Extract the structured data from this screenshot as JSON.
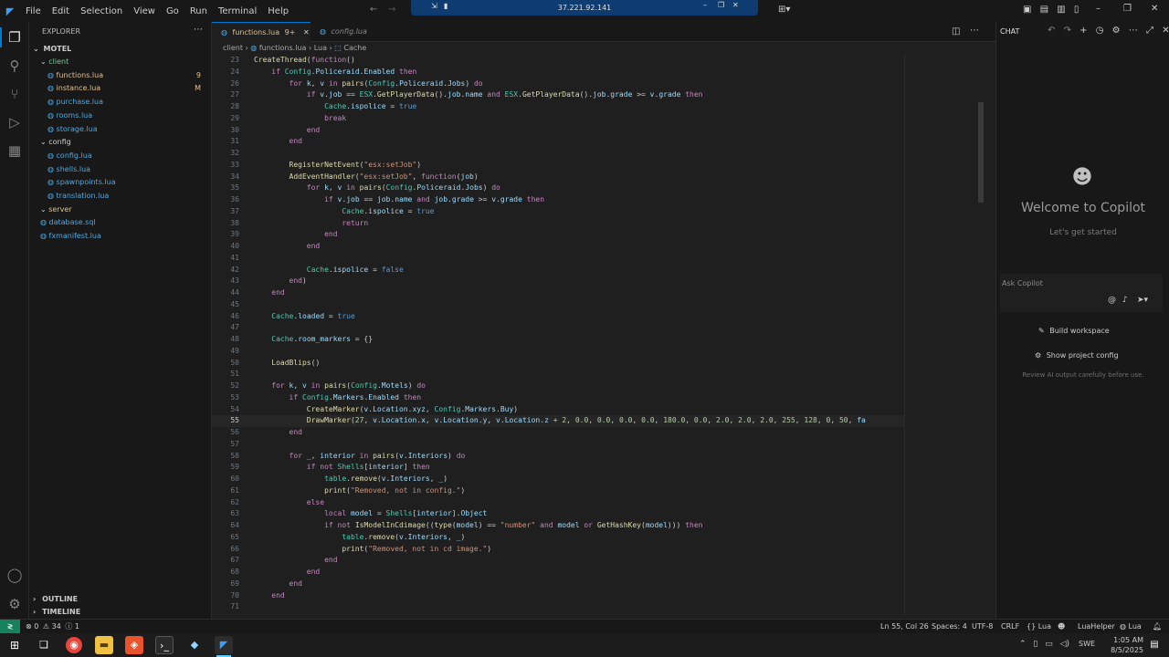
{
  "titlebar": {
    "menu": [
      "File",
      "Edit",
      "Selection",
      "View",
      "Go",
      "Run",
      "Terminal",
      "Help"
    ],
    "remote_address": "37.221.92.141"
  },
  "sidebar": {
    "header": "EXPLORER",
    "root": "MOTEL",
    "items": [
      {
        "label": "client",
        "type": "folder",
        "color": "#73c991"
      },
      {
        "label": "functions.lua",
        "type": "file",
        "color": "#e2c08d",
        "badge": "9"
      },
      {
        "label": "instance.lua",
        "type": "file",
        "color": "#e2c08d",
        "badge": "M"
      },
      {
        "label": "purchase.lua",
        "type": "file",
        "color": "#4fa8e0",
        "badge": ""
      },
      {
        "label": "rooms.lua",
        "type": "file",
        "color": "#4fa8e0",
        "badge": ""
      },
      {
        "label": "storage.lua",
        "type": "file",
        "color": "#4fa8e0",
        "badge": ""
      },
      {
        "label": "config",
        "type": "folder",
        "color": "#cccccc",
        "badge": ""
      },
      {
        "label": "config.lua",
        "type": "file",
        "color": "#4fa8e0",
        "badge": ""
      },
      {
        "label": "shells.lua",
        "type": "file",
        "color": "#4fa8e0",
        "badge": ""
      },
      {
        "label": "spawnpoints.lua",
        "type": "file",
        "color": "#4fa8e0",
        "badge": ""
      },
      {
        "label": "translation.lua",
        "type": "file",
        "color": "#4fa8e0",
        "badge": ""
      },
      {
        "label": "server",
        "type": "folder",
        "color": "#e2c08d",
        "badge": ""
      },
      {
        "label": "database.sql",
        "type": "file",
        "color": "#4fa8e0",
        "badge": ""
      },
      {
        "label": "fxmanifest.lua",
        "type": "file",
        "color": "#4fa8e0",
        "badge": ""
      }
    ],
    "outline": "OUTLINE",
    "timeline": "TIMELINE"
  },
  "tabs": [
    {
      "label": "functions.lua",
      "badge": "9+",
      "active": true
    },
    {
      "label": "config.lua",
      "badge": "",
      "active": false
    }
  ],
  "breadcrumb": [
    "client",
    "functions.lua",
    "Lua",
    "Cache"
  ],
  "code": [
    {
      "n": "23",
      "t": "CreateThread(function()"
    },
    {
      "n": "24",
      "t": "    if Config.Policeraid.Enabled then"
    },
    {
      "n": "26",
      "t": "        for k, v in pairs(Config.Policeraid.Jobs) do"
    },
    {
      "n": "27",
      "t": "            if v.job == ESX.GetPlayerData().job.name and ESX.GetPlayerData().job.grade >= v.grade then"
    },
    {
      "n": "28",
      "t": "                Cache.ispolice = true"
    },
    {
      "n": "29",
      "t": "                break"
    },
    {
      "n": "30",
      "t": "            end"
    },
    {
      "n": "31",
      "t": "        end"
    },
    {
      "n": "32",
      "t": ""
    },
    {
      "n": "33",
      "t": "        RegisterNetEvent(\"esx:setJob\")"
    },
    {
      "n": "34",
      "t": "        AddEventHandler(\"esx:setJob\", function(job)"
    },
    {
      "n": "35",
      "t": "            for k, v in pairs(Config.Policeraid.Jobs) do"
    },
    {
      "n": "36",
      "t": "                if v.job == job.name and job.grade >= v.grade then"
    },
    {
      "n": "37",
      "t": "                    Cache.ispolice = true"
    },
    {
      "n": "38",
      "t": "                    return"
    },
    {
      "n": "39",
      "t": "                end"
    },
    {
      "n": "40",
      "t": "            end"
    },
    {
      "n": "41",
      "t": ""
    },
    {
      "n": "42",
      "t": "            Cache.ispolice = false"
    },
    {
      "n": "43",
      "t": "        end)"
    },
    {
      "n": "44",
      "t": "    end"
    },
    {
      "n": "45",
      "t": ""
    },
    {
      "n": "46",
      "t": "    Cache.loaded = true"
    },
    {
      "n": "47",
      "t": ""
    },
    {
      "n": "48",
      "t": "    Cache.room_markers = {}"
    },
    {
      "n": "49",
      "t": ""
    },
    {
      "n": "50",
      "t": "    LoadBlips()"
    },
    {
      "n": "51",
      "t": ""
    },
    {
      "n": "52",
      "t": "    for k, v in pairs(Config.Motels) do"
    },
    {
      "n": "53",
      "t": "        if Config.Markers.Enabled then"
    },
    {
      "n": "54",
      "t": "            CreateMarker(v.Location.xyz, Config.Markers.Buy)"
    },
    {
      "n": "55",
      "t": "            DrawMarker(27, v.Location.x, v.Location.y, v.Location.z + 2, 0.0, 0.0, 0.0, 0.0, 180.0, 0.0, 2.0, 2.0, 2.0, 255, 128, 0, 50, fa"
    },
    {
      "n": "56",
      "t": "        end"
    },
    {
      "n": "57",
      "t": ""
    },
    {
      "n": "58",
      "t": "        for _, interior in pairs(v.Interiors) do"
    },
    {
      "n": "59",
      "t": "            if not Shells[interior] then"
    },
    {
      "n": "60",
      "t": "                table.remove(v.Interiors, _)"
    },
    {
      "n": "61",
      "t": "                print(\"Removed, not in config.\")"
    },
    {
      "n": "62",
      "t": "            else"
    },
    {
      "n": "63",
      "t": "                local model = Shells[interior].Object"
    },
    {
      "n": "64",
      "t": "                if not IsModelInCdimage((type(model) == \"number\" and model or GetHashKey(model))) then"
    },
    {
      "n": "65",
      "t": "                    table.remove(v.Interiors, _)"
    },
    {
      "n": "66",
      "t": "                    print(\"Removed, not in cd image.\")"
    },
    {
      "n": "67",
      "t": "                end"
    },
    {
      "n": "68",
      "t": "            end"
    },
    {
      "n": "69",
      "t": "        end"
    },
    {
      "n": "70",
      "t": "    end"
    },
    {
      "n": "71",
      "t": ""
    }
  ],
  "chat": {
    "header": "CHAT",
    "welcome": "Welcome to Copilot",
    "subtitle": "Let's get started",
    "input_placeholder": "Ask Copilot",
    "build_workspace": "Build workspace",
    "show_config": "Show project config",
    "disclaimer": "Review AI output carefully before use."
  },
  "statusbar": {
    "errors": "0",
    "warnings": "34",
    "info": "1",
    "position": "Ln 55, Col 26",
    "spaces": "Spaces: 4",
    "encoding": "UTF-8",
    "eol": "CRLF",
    "language_braces": "Lua",
    "extension": "LuaHelper",
    "language": "Lua"
  },
  "taskbar": {
    "time": "1:05 AM",
    "date": "8/5/2025",
    "lang": "SWE"
  },
  "colors": {
    "accent": "#0078d4",
    "remote": "#16825d"
  }
}
